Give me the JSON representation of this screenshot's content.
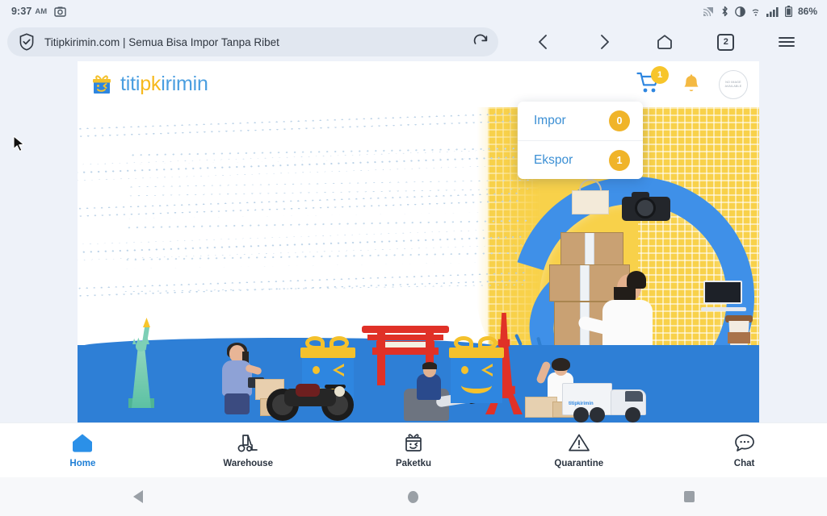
{
  "status_bar": {
    "time": "9:37",
    "ampm": "AM",
    "screenshot_icon": "camera-icon",
    "cast_icon": "cast-icon",
    "bluetooth_icon": "bluetooth-icon",
    "dnd_icon": "do-not-disturb-icon",
    "wifi_icon": "wifi-icon",
    "signal_icon": "signal-icon",
    "battery_icon": "battery-icon",
    "battery_text": "86%"
  },
  "browser": {
    "security_icon": "shield-check-icon",
    "url_title": "Titipkirimin.com | Semua Bisa Impor Tanpa Ribet",
    "reload_icon": "reload-icon",
    "back_icon": "chevron-left-icon",
    "forward_icon": "chevron-right-icon",
    "home_icon": "home-pentagon-icon",
    "tabs_icon": "tab-counter-icon",
    "tab_count": "2",
    "menu_icon": "hamburger-menu-icon"
  },
  "site_header": {
    "logo_icon": "gift-box-logo-icon",
    "logo_part1": "titi",
    "logo_part2": "pk",
    "logo_part3": "irimin",
    "cart_icon": "shopping-cart-icon",
    "cart_badge": "1",
    "bell_icon": "notification-bell-icon",
    "avatar_line1": "NO IMAGE",
    "avatar_line2": "AVAILABLE"
  },
  "dropdown": {
    "items": [
      {
        "label": "Impor",
        "badge": "0"
      },
      {
        "label": "Ekspor",
        "badge": "1"
      }
    ]
  },
  "hero": {
    "alt": "promotional banner with boxes, landmarks and delivery illustrations"
  },
  "app_nav": {
    "items": [
      {
        "label": "Home",
        "icon": "home-icon",
        "active": true
      },
      {
        "label": "Warehouse",
        "icon": "forklift-icon",
        "active": false
      },
      {
        "label": "Paketku",
        "icon": "gift-package-icon",
        "active": false
      },
      {
        "label": "Quarantine",
        "icon": "warning-triangle-icon",
        "active": false
      },
      {
        "label": "Chat",
        "icon": "chat-bubble-icon",
        "active": false
      }
    ]
  },
  "android_nav": {
    "back_icon": "android-back-icon",
    "home_icon": "android-home-icon",
    "recents_icon": "android-recents-icon"
  },
  "colors": {
    "brand_blue": "#3b8fd4",
    "brand_yellow": "#f0b429",
    "accent_blue": "#1f7fd6",
    "chrome_bg": "#eef2f9"
  }
}
